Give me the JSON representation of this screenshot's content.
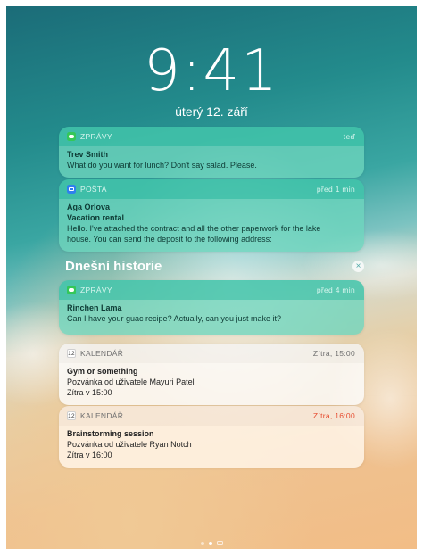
{
  "lockscreen": {
    "time": "9:41",
    "date": "úterý 12. září"
  },
  "notifications_top": [
    {
      "app": "ZPRÁVY",
      "icon": "messages-icon",
      "time": "teď",
      "title": "Trev Smith",
      "subtitle": "",
      "lines": [
        "What do you want for lunch? Don't say salad. Please."
      ]
    },
    {
      "app": "POŠTA",
      "icon": "mail-icon",
      "time": "před 1 min",
      "title": "Aga Orlova",
      "subtitle": "Vacation rental",
      "lines": [
        "Hello. I've attached the contract and all the other paperwork for the lake",
        "house. You can send the deposit to the following address:"
      ]
    }
  ],
  "history": {
    "label": "Dnešní historie",
    "clear_icon": "×"
  },
  "notifications_history": [
    {
      "app": "ZPRÁVY",
      "icon": "messages-icon",
      "time": "před 4 min",
      "title": "Rinchen Lama",
      "lines": [
        "Can I have your guac recipe? Actually, can you just make it?"
      ]
    },
    {
      "app": "KALENDÁŘ",
      "icon": "calendar-icon",
      "icon_text": "12",
      "time": "Zítra, 15:00",
      "title": "Gym or something",
      "lines": [
        "Pozvánka od uživatele Mayuri Patel",
        "Zítra v 15:00"
      ]
    },
    {
      "app": "KALENDÁŘ",
      "icon": "calendar-icon",
      "icon_text": "12",
      "time": "Zítra, 16:00",
      "time_color": "#e64a2e",
      "title": "Brainstorming session",
      "lines": [
        "Pozvánka od uživatele Ryan Notch",
        "Zítra v 16:00"
      ]
    }
  ]
}
